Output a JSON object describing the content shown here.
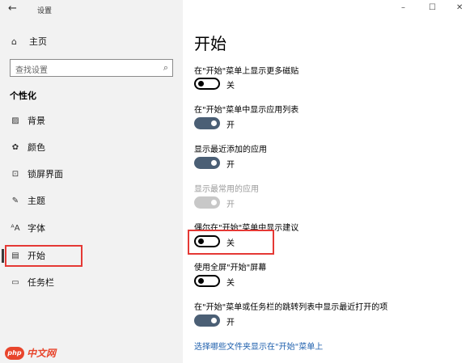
{
  "app": {
    "back_icon": "←",
    "title": "设置"
  },
  "window_controls": {
    "minimize": "–",
    "maximize": "☐",
    "close": "✕"
  },
  "sidebar": {
    "home": {
      "icon": "⌂",
      "label": "主页"
    },
    "search": {
      "placeholder": "查找设置",
      "icon": "⌕"
    },
    "section": "个性化",
    "items": [
      {
        "icon": "▨",
        "label": "背景"
      },
      {
        "icon": "✿",
        "label": "颜色"
      },
      {
        "icon": "⊡",
        "label": "锁屏界面"
      },
      {
        "icon": "✎",
        "label": "主题"
      },
      {
        "icon": "ᴬA",
        "label": "字体"
      },
      {
        "icon": "▤",
        "label": "开始"
      },
      {
        "icon": "▭",
        "label": "任务栏"
      }
    ],
    "selected_index": 5
  },
  "main": {
    "title": "开始",
    "settings": [
      {
        "label": "在\"开始\"菜单上显示更多磁贴",
        "state": "关"
      },
      {
        "label": "在\"开始\"菜单中显示应用列表",
        "state": "开"
      },
      {
        "label": "显示最近添加的应用",
        "state": "开"
      },
      {
        "label": "显示最常用的应用",
        "state": "开"
      },
      {
        "label": "偶尔在\"开始\"菜单中显示建议",
        "state": "关"
      },
      {
        "label": "使用全屏\"开始\"屏幕",
        "state": "关"
      },
      {
        "label": "在\"开始\"菜单或任务栏的跳转列表中显示最近打开的项",
        "state": "开"
      }
    ],
    "link": "选择哪些文件夹显示在\"开始\"菜单上"
  },
  "watermark": {
    "logo": "php",
    "text": "中文网"
  },
  "colors": {
    "toggle_on": "#4b5f75",
    "highlight_box": "#e53935",
    "link": "#1e5fad"
  }
}
